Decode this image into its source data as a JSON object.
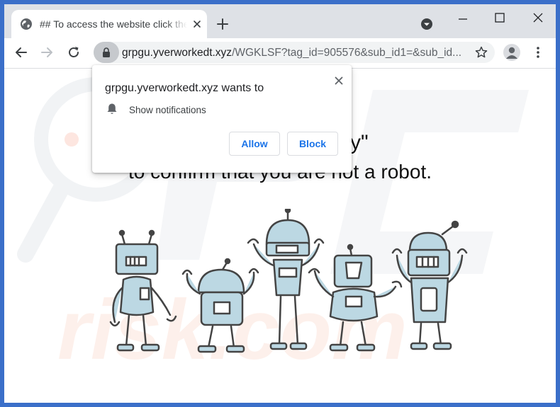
{
  "tab": {
    "title": "## To access the website click the",
    "icon": "globe-icon"
  },
  "toolbar": {
    "url_host": "grpgu.yverworkedt.xyz",
    "url_path": "/WGKLSF?tag_id=905576&sub_id1=&sub_id..."
  },
  "popup": {
    "title": "grpgu.yverworkedt.xyz wants to",
    "permission": "Show notifications",
    "allow_label": "Allow",
    "block_label": "Block"
  },
  "page": {
    "headline_partial": "y\"",
    "headline": "to confirm that you are not a robot."
  },
  "colors": {
    "accent": "#1a73e8",
    "desktop": "#3b6fc9",
    "tabstrip": "#dee1e6",
    "robot_fill": "#bcd8e3",
    "robot_stroke": "#444444"
  }
}
